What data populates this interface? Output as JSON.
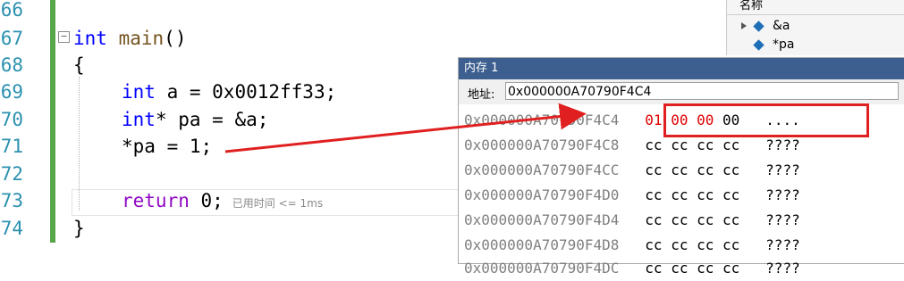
{
  "editor": {
    "line_numbers": [
      "66",
      "67",
      "68",
      "69",
      "70",
      "71",
      "72",
      "73",
      "74"
    ],
    "lines": {
      "l67_kw": "int",
      "l67_fn": "main",
      "l67_rest": "()",
      "l68": "{",
      "l69_kw": "int",
      "l69_rest": " a = 0x0012ff33;",
      "l70_kw": "int",
      "l70_rest": "* pa = &a;",
      "l71": "*pa = 1;",
      "l73_kw": "return",
      "l73_rest": " 0;",
      "l73_hint": "已用时间 <= 1ms",
      "l74": "}"
    }
  },
  "watch": {
    "header": "名称",
    "rows": [
      "&a",
      "*pa"
    ]
  },
  "memory": {
    "title": "内存 1",
    "address_label": "地址:",
    "address_value": "0x000000A70790F4C4",
    "rows": [
      {
        "addr": "0x000000A70790F4C4",
        "bytes": "01 00 00 00",
        "ascii": "...."
      },
      {
        "addr": "0x000000A70790F4C8",
        "bytes": "cc cc cc cc",
        "ascii": "????"
      },
      {
        "addr": "0x000000A70790F4CC",
        "bytes": "cc cc cc cc",
        "ascii": "????"
      },
      {
        "addr": "0x000000A70790F4D0",
        "bytes": "cc cc cc cc",
        "ascii": "????"
      },
      {
        "addr": "0x000000A70790F4D4",
        "bytes": "cc cc cc cc",
        "ascii": "????"
      },
      {
        "addr": "0x000000A70790F4D8",
        "bytes": "cc cc cc cc",
        "ascii": "????"
      },
      {
        "addr": "0x000000A70790F4DC",
        "bytes": "cc cc cc cc",
        "ascii": "????"
      }
    ],
    "first_row_bytes": {
      "b0": "01",
      "b1": "00",
      "b2": "00",
      "b3": "00"
    }
  },
  "colors": {
    "keyword": "#0000ff",
    "line_number": "#2b91af",
    "annotation": "#e02020",
    "title_bar": "#3d5f8f"
  }
}
